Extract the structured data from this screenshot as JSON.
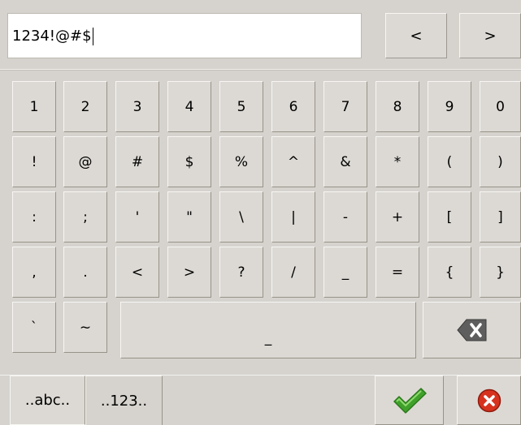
{
  "input": {
    "value": "1234!@#$"
  },
  "nav": {
    "prev": "<",
    "next": ">"
  },
  "rows": [
    [
      "1",
      "2",
      "3",
      "4",
      "5",
      "6",
      "7",
      "8",
      "9",
      "0"
    ],
    [
      "!",
      "@",
      "#",
      "$",
      "%",
      "^",
      "&",
      "*",
      "(",
      ")"
    ],
    [
      ":",
      ";",
      "'",
      "\"",
      "\\",
      "|",
      "-",
      "+",
      "[",
      "]"
    ],
    [
      ",",
      ".",
      "<",
      ">",
      "?",
      "/",
      "_",
      "=",
      "{",
      "}"
    ]
  ],
  "row5": {
    "backtick": "`",
    "tilde": "~",
    "space": "_"
  },
  "tabs": {
    "abc": "..abc..",
    "num": "..123.."
  },
  "icons": {
    "backspace": "backspace-icon",
    "confirm": "checkmark-icon",
    "cancel": "cancel-icon"
  },
  "colors": {
    "confirm": "#3fa12a",
    "cancel": "#d6321e"
  }
}
